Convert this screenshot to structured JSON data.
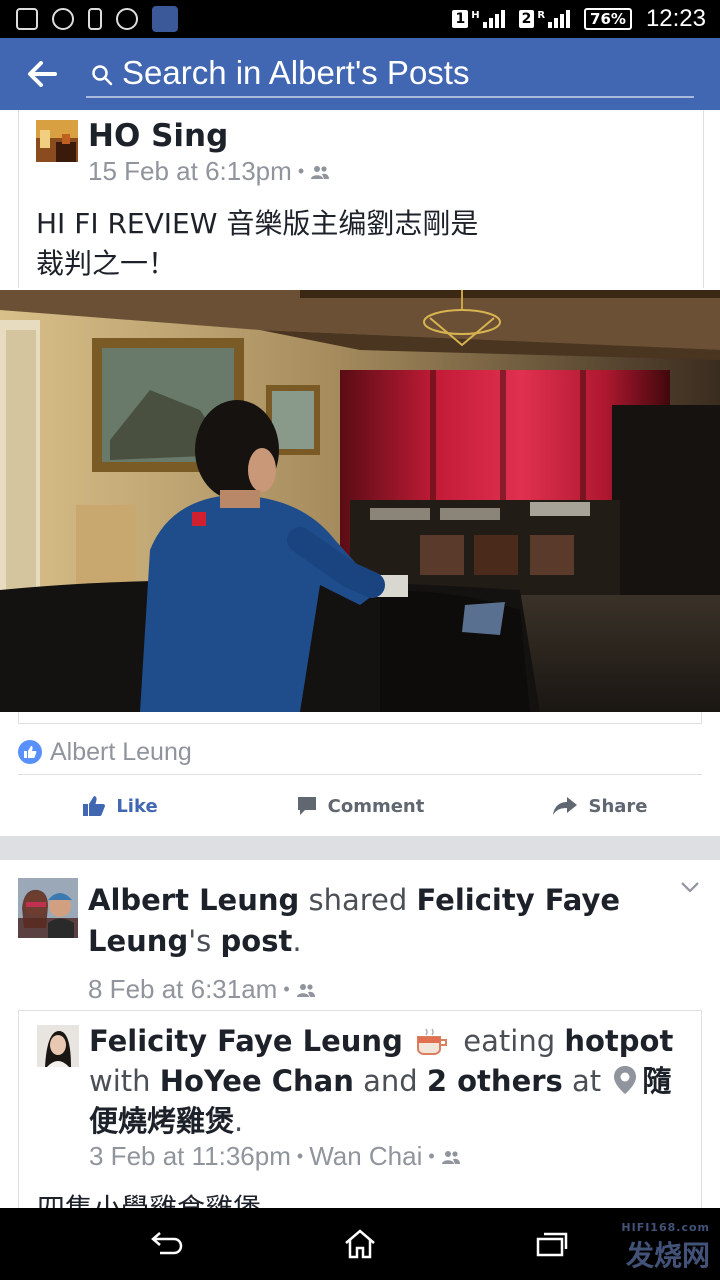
{
  "status_bar": {
    "sim1": "1",
    "sim1_type": "H",
    "sim2": "2",
    "sim2_type": "R",
    "battery": "76%",
    "time": "12:23"
  },
  "header": {
    "search_placeholder": "Search in Albert's Posts"
  },
  "post1": {
    "author": "HO Sing",
    "timestamp": "15 Feb at 6:13pm",
    "separator": "•",
    "text_line1": "HI FI REVIEW 音樂版主编劉志剛是",
    "text_line2": "裁判之一！",
    "liked_by": "Albert Leung",
    "actions": {
      "like": "Like",
      "comment": "Comment",
      "share": "Share"
    }
  },
  "post2": {
    "sharer": "Albert Leung",
    "shared_word": "shared",
    "original_author": "Felicity Faye Leung",
    "possessive": "'s",
    "post_word": "post",
    "period": ".",
    "timestamp": "8 Feb at 6:31am",
    "separator": "•",
    "inner": {
      "author": "Felicity Faye Leung",
      "activity": "eating",
      "food": "hotpot",
      "with_word": "with",
      "tagged": "HoYee Chan",
      "and_word": "and",
      "others": "2 others",
      "at_word": "at",
      "place": "隨便燒烤雞煲",
      "period": ".",
      "timestamp": "3 Feb at 11:36pm",
      "location": "Wan Chai",
      "separator": "•",
      "text_preview": "四隻小學雞食雞煲"
    }
  },
  "watermark": {
    "site": "HIFI168.com",
    "text": "发烧网"
  }
}
